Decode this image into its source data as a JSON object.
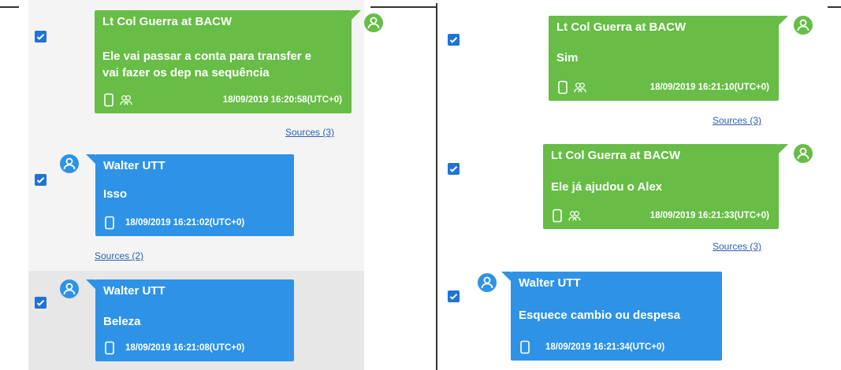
{
  "left": {
    "messages": [
      {
        "sender": "Lt Col Guerra at BACW",
        "lines": [
          "Ele vai passar a conta para transfer e",
          "vai fazer os dep na sequência"
        ],
        "timestamp": "18/09/2019 16:20:58(UTC+0)",
        "sources": "Sources (3)",
        "direction": "outgoing",
        "checked": true
      },
      {
        "sender": "Walter UTT",
        "lines": [
          "Isso"
        ],
        "timestamp": "18/09/2019 16:21:02(UTC+0)",
        "sources": "Sources (2)",
        "direction": "incoming",
        "checked": true
      },
      {
        "sender": "Walter UTT",
        "lines": [
          "Beleza"
        ],
        "timestamp": "18/09/2019 16:21:08(UTC+0)",
        "direction": "incoming",
        "checked": true,
        "highlighted": true
      }
    ]
  },
  "right": {
    "messages": [
      {
        "sender": "Lt Col Guerra at BACW",
        "lines": [
          "Sim"
        ],
        "timestamp": "18/09/2019 16:21:10(UTC+0)",
        "sources": "Sources (3)",
        "direction": "outgoing",
        "checked": true
      },
      {
        "sender": "Lt Col Guerra at BACW",
        "lines": [
          "Ele já ajudou o Alex"
        ],
        "timestamp": "18/09/2019 16:21:33(UTC+0)",
        "sources": "Sources (3)",
        "direction": "outgoing",
        "checked": true
      },
      {
        "sender": "Walter UTT",
        "lines": [
          "Esquece cambio ou despesa"
        ],
        "timestamp": "18/09/2019 16:21:34(UTC+0)",
        "direction": "incoming",
        "checked": true
      }
    ]
  },
  "colors": {
    "outgoing_bubble": "#67bd45",
    "incoming_bubble": "#2e93e6",
    "checkbox": "#1f73d6",
    "sources_link": "#2c5fae"
  },
  "icons": {
    "avatar": "person-icon",
    "checkbox": "checkmark-icon",
    "device": "phone-icon",
    "participants": "group-icon"
  }
}
